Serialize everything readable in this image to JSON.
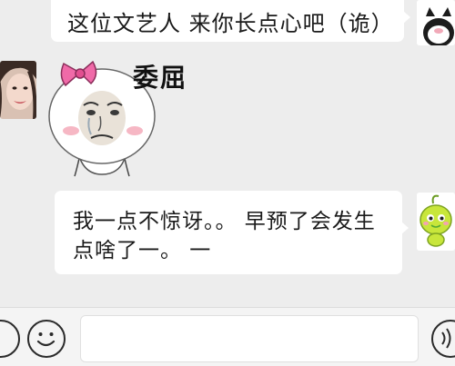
{
  "messages": [
    {
      "side": "right",
      "text": "这位文艺人 来你长点心吧（诡）",
      "avatar": "cartoon-cat-avatar"
    },
    {
      "side": "left",
      "sticker_text": "委屈",
      "sticker": "crying-meme-face-with-pink-bow",
      "avatar": "girl-photo-avatar"
    },
    {
      "side": "right",
      "lines": [
        "我一点不惊讶。。 早预了会发生",
        "点啥了一。 一"
      ],
      "avatar": "green-cartoon-avatar"
    }
  ],
  "input_bar": {
    "icons": [
      "more-icon",
      "emoji-icon",
      "voice-icon"
    ],
    "text_value": ""
  },
  "colors": {
    "chat_background": "#ededed",
    "bubble": "#ffffff",
    "input_bar": "#f4f4f4"
  }
}
